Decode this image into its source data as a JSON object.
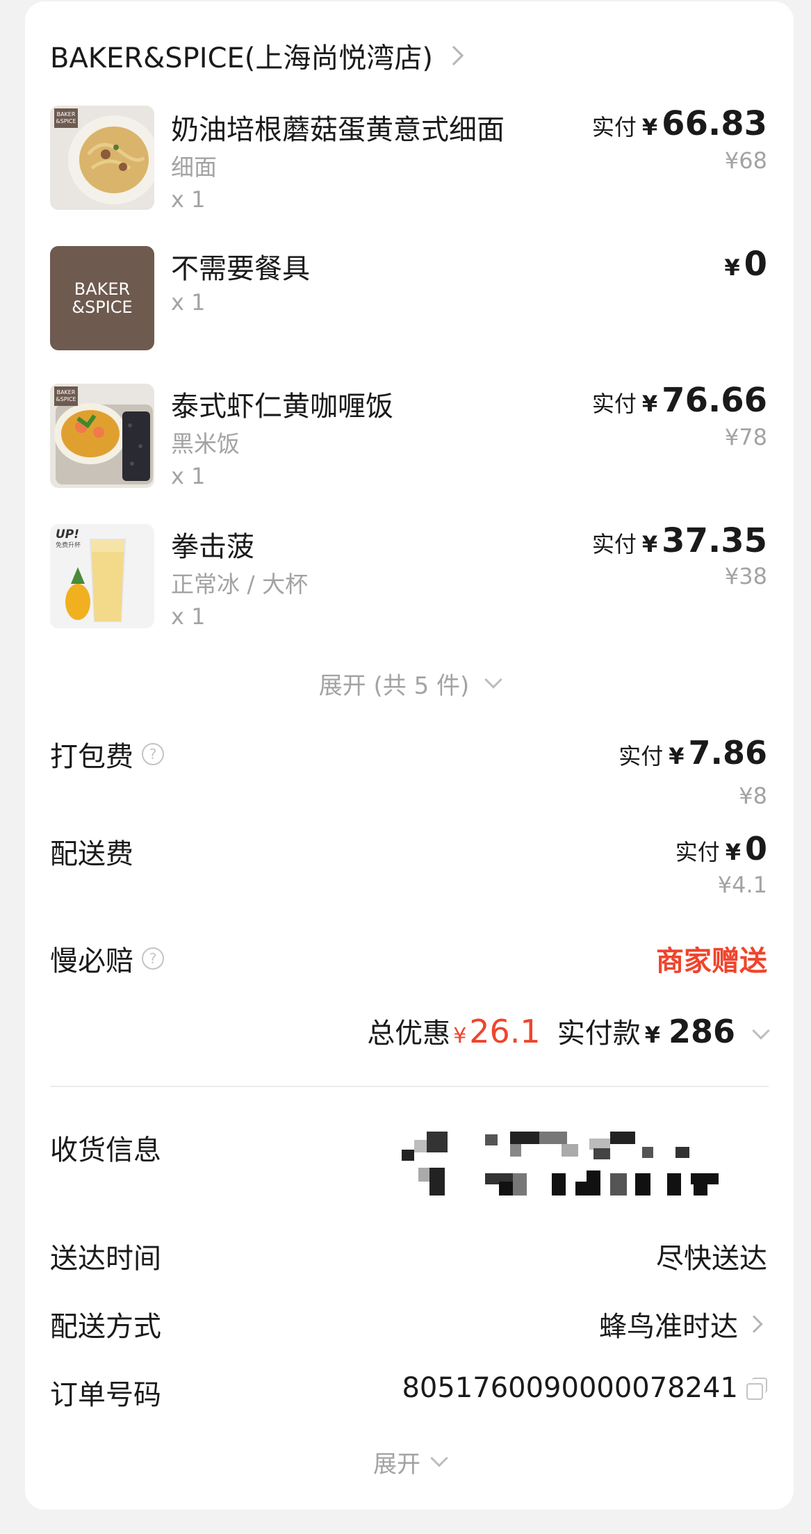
{
  "store": {
    "name": "BAKER&SPICE(上海尚悦湾店)"
  },
  "brand_logo_text": [
    "BAKER",
    "&SPICE"
  ],
  "items": [
    {
      "name": "奶油培根蘑菇蛋黄意式细面",
      "spec": "细面",
      "qty": "x 1",
      "paid_label": "实付",
      "yen": "¥",
      "paid": "66.83",
      "original": "¥68"
    },
    {
      "name": "不需要餐具",
      "spec": "",
      "qty": "x 1",
      "paid_label": "",
      "yen": "¥",
      "paid": "0",
      "original": ""
    },
    {
      "name": "泰式虾仁黄咖喱饭",
      "spec": "黑米饭",
      "qty": "x 1",
      "paid_label": "实付",
      "yen": "¥",
      "paid": "76.66",
      "original": "¥78"
    },
    {
      "name": "拳击菠",
      "spec": "正常冰 / 大杯",
      "qty": "x 1",
      "paid_label": "实付",
      "yen": "¥",
      "paid": "37.35",
      "original": "¥38",
      "badge": "UP!",
      "badge_sub": "免费升杯"
    }
  ],
  "expand_items": "展开 (共 5 件)",
  "fees": {
    "packing": {
      "label": "打包费",
      "paid_label": "实付",
      "yen": "¥",
      "paid": "7.86",
      "original": "¥8"
    },
    "delivery": {
      "label": "配送费",
      "paid_label": "实付",
      "yen": "¥",
      "paid": "0",
      "original": "¥4.1"
    },
    "late_guarantee": {
      "label": "慢必赔",
      "value": "商家赠送"
    }
  },
  "totals": {
    "discount_label": "总优惠",
    "yen": "¥",
    "discount": "26.1",
    "paid_label": "实付款",
    "paid": "286"
  },
  "info": {
    "address_label": "收货信息",
    "time_label": "送达时间",
    "time_value": "尽快送达",
    "method_label": "配送方式",
    "method_value": "蜂鸟准时达",
    "order_label": "订单号码",
    "order_value": "8051760090000078241"
  },
  "expand_more": "展开",
  "colors": {
    "accent_red": "#f0442c",
    "muted": "#a3a3a3",
    "logo_brown": "#6e5a4f"
  }
}
